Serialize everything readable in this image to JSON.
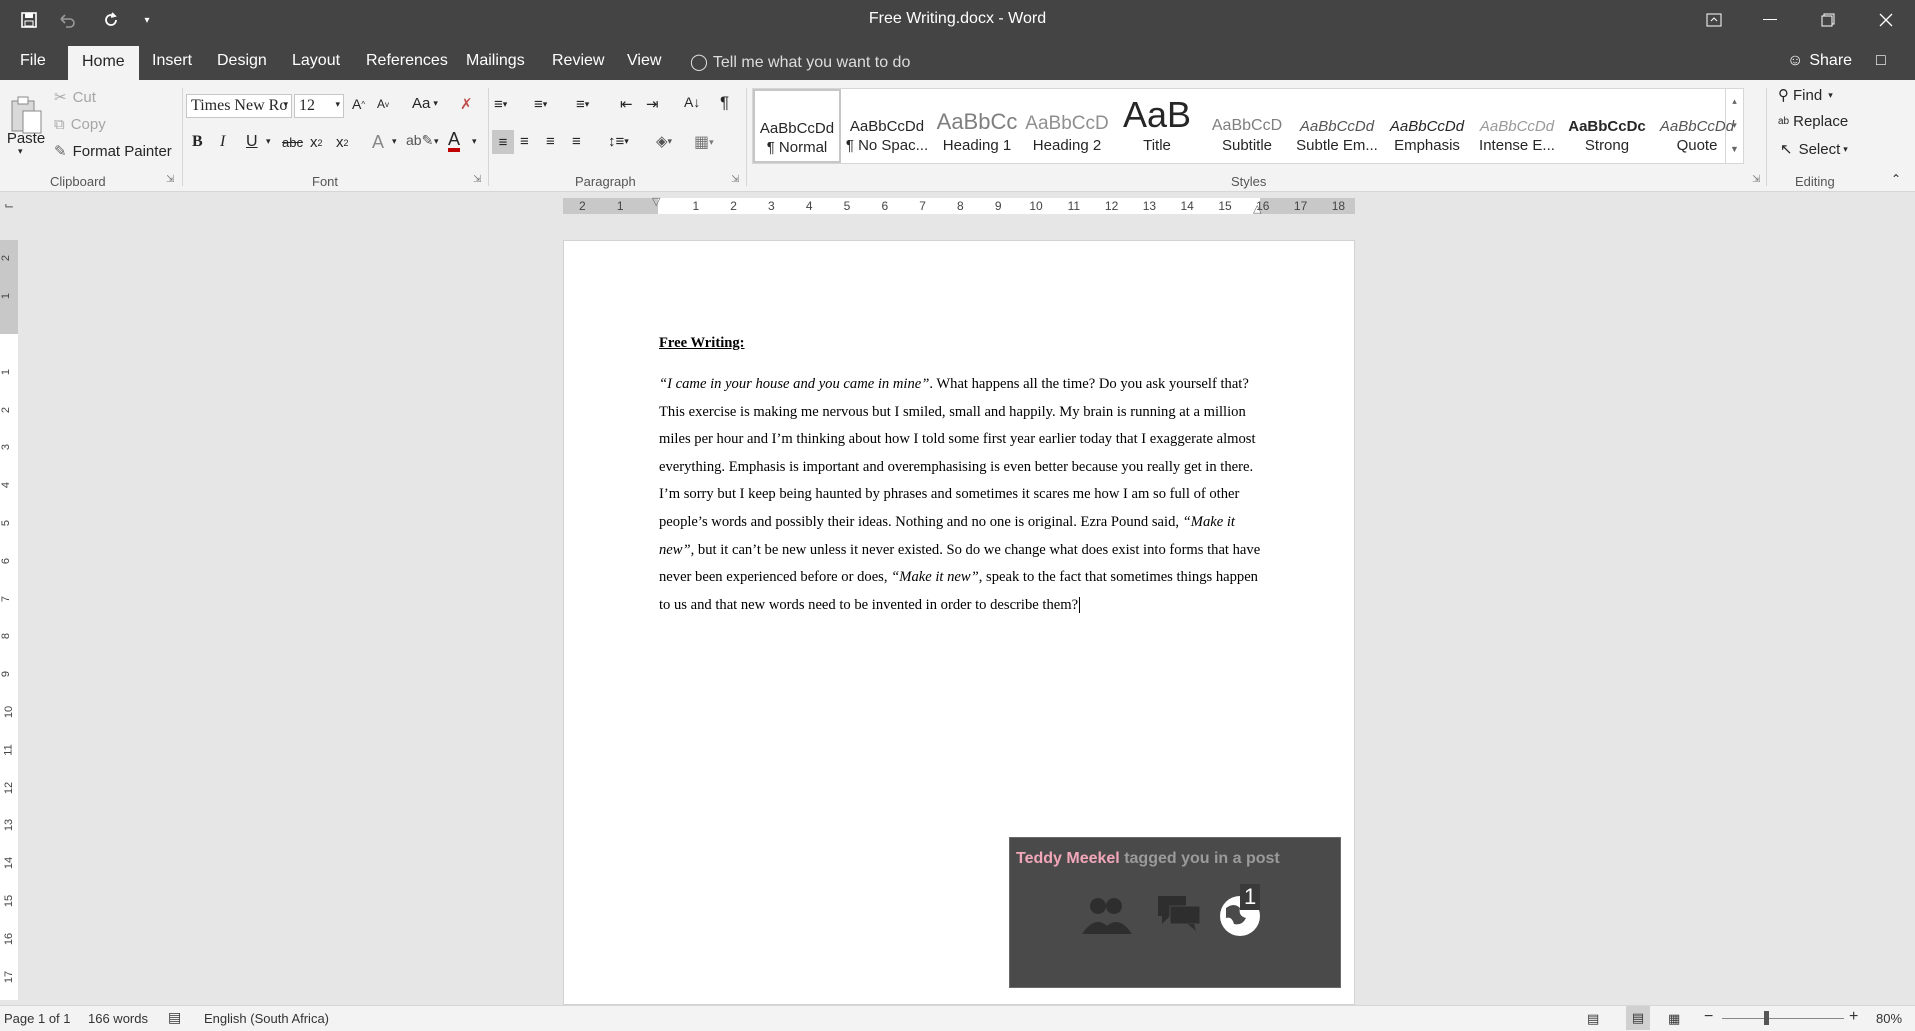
{
  "window": {
    "title": "Free Writing.docx  -  Word"
  },
  "menu": {
    "tabs": [
      "File",
      "Home",
      "Insert",
      "Design",
      "Layout",
      "References",
      "Mailings",
      "Review",
      "View"
    ],
    "tell_me": "Tell me what you want to do",
    "share": "Share"
  },
  "clipboard": {
    "paste": "Paste",
    "cut": "Cut",
    "copy": "Copy",
    "format_painter": "Format Painter",
    "label": "Clipboard"
  },
  "font": {
    "family": "Times New Ro",
    "size": "12",
    "label": "Font",
    "case_btn": "Aa"
  },
  "paragraph": {
    "label": "Paragraph"
  },
  "styles": {
    "label": "Styles",
    "items": [
      {
        "preview": "AaBbCcDd",
        "name": "¶ Normal"
      },
      {
        "preview": "AaBbCcDd",
        "name": "¶ No Spac..."
      },
      {
        "preview": "AaBbCc",
        "name": "Heading 1"
      },
      {
        "preview": "AaBbCcD",
        "name": "Heading 2"
      },
      {
        "preview": "AaB",
        "name": "Title"
      },
      {
        "preview": "AaBbCcD",
        "name": "Subtitle"
      },
      {
        "preview": "AaBbCcDd",
        "name": "Subtle Em..."
      },
      {
        "preview": "AaBbCcDd",
        "name": "Emphasis"
      },
      {
        "preview": "AaBbCcDd",
        "name": "Intense E..."
      },
      {
        "preview": "AaBbCcDc",
        "name": "Strong"
      },
      {
        "preview": "AaBbCcDd",
        "name": "Quote"
      }
    ]
  },
  "editing": {
    "find": "Find",
    "replace": "Replace",
    "select": "Select",
    "label": "Editing"
  },
  "ruler": {
    "h_ticks": [
      "2",
      "1",
      "1",
      "2",
      "3",
      "4",
      "5",
      "6",
      "7",
      "8",
      "9",
      "10",
      "11",
      "12",
      "13",
      "14",
      "15",
      "16",
      "17",
      "18"
    ],
    "v_ticks": [
      "2",
      "1",
      "1",
      "2",
      "3",
      "4",
      "5",
      "6",
      "7",
      "8",
      "9",
      "10",
      "11",
      "12",
      "13",
      "14",
      "15",
      "16",
      "17"
    ]
  },
  "document": {
    "heading": "Free Writing:",
    "q1": "“I came in your house and you came in mine”",
    "p1": ". What happens all the time? Do you ask yourself that? This exercise is making me nervous but I smiled, small and happily.  My brain is running at a million miles per hour and I’m thinking about how I told some first year earlier today that I exaggerate almost everything. Emphasis is important and overemphasising is even better because you really get in there. I’m sorry but I keep being haunted by phrases and sometimes it scares me how I am so full of other people’s words and possibly their ideas. Nothing and no one is original. Ezra Pound said, ",
    "q2": "“Make it new”",
    "p2": ", but it can’t be new unless it never existed. So do we change what does exist into forms that have never been experienced before or does, ",
    "q3": "“Make it new”",
    "p3": ", speak to the fact that sometimes things happen to us and that new words need to be invented in order to describe them?"
  },
  "notification": {
    "who": "Teddy Meekel",
    "text": " tagged you in a post",
    "count": "1"
  },
  "status": {
    "page": "Page 1 of 1",
    "words": "166 words",
    "language": "English (South Africa)",
    "zoom": "80%"
  }
}
